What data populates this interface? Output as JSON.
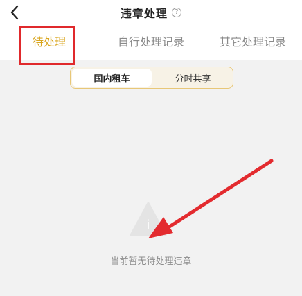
{
  "header": {
    "title": "违章处理",
    "help_glyph": "?"
  },
  "tabs": [
    {
      "label": "待处理",
      "active": true
    },
    {
      "label": "自行处理记录",
      "active": false
    },
    {
      "label": "其它处理记录",
      "active": false
    }
  ],
  "segment": [
    {
      "label": "国内租车",
      "active": true
    },
    {
      "label": "分时共享",
      "active": false
    }
  ],
  "empty": {
    "message": "当前暂无待处理违章",
    "icon_glyph": "i"
  },
  "colors": {
    "accent": "#d9a51d",
    "highlight": "#e0292c",
    "arrow": "#e32b2f"
  }
}
